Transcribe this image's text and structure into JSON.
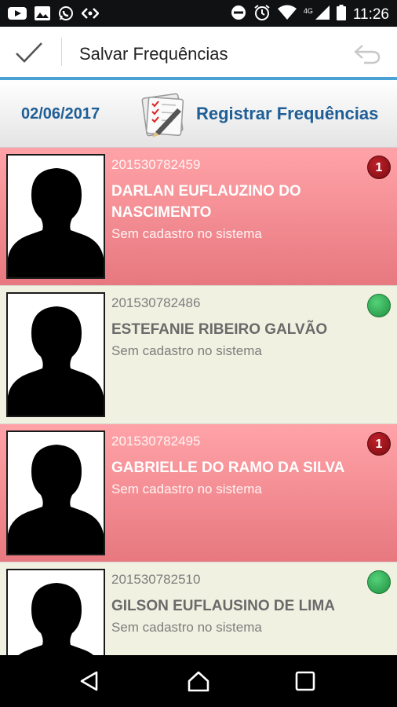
{
  "status_bar": {
    "time": "11:26",
    "network": "4G",
    "left_icons": [
      "youtube-icon",
      "gallery-icon",
      "whatsapp-icon",
      "code-icon"
    ],
    "right_icons": [
      "do-not-disturb-icon",
      "alarm-icon",
      "wifi-icon",
      "signal-icon",
      "battery-icon"
    ]
  },
  "action_bar": {
    "title": "Salvar Frequências",
    "confirm_icon": "check-icon",
    "undo_icon": "undo-icon"
  },
  "header": {
    "date": "02/06/2017",
    "register_label": "Registrar Frequências",
    "icon": "checklist-pen-icon"
  },
  "students": [
    {
      "registration": "201530782459",
      "name": "DARLAN EUFLAUZINO DO NASCIMENTO",
      "status": "Sem cadastro no sistema",
      "state": "absent",
      "absences": "1"
    },
    {
      "registration": "201530782486",
      "name": "ESTEFANIE RIBEIRO GALVÃO",
      "status": "Sem cadastro no sistema",
      "state": "present",
      "absences": ""
    },
    {
      "registration": "201530782495",
      "name": "GABRIELLE DO RAMO DA SILVA",
      "status": "Sem cadastro no sistema",
      "state": "absent",
      "absences": "1"
    },
    {
      "registration": "201530782510",
      "name": "GILSON EUFLAUSINO DE LIMA",
      "status": "Sem cadastro no sistema",
      "state": "present",
      "absences": ""
    }
  ],
  "colors": {
    "accent": "#4aa3d4",
    "header_text": "#1f5e96",
    "absent_row": "#f48c93",
    "present_row": "#f1f1e2",
    "absent_badge": "#9e1520",
    "present_badge": "#2ea84f"
  },
  "nav_bar": {
    "icons": [
      "back-icon",
      "home-icon",
      "recents-icon"
    ]
  }
}
